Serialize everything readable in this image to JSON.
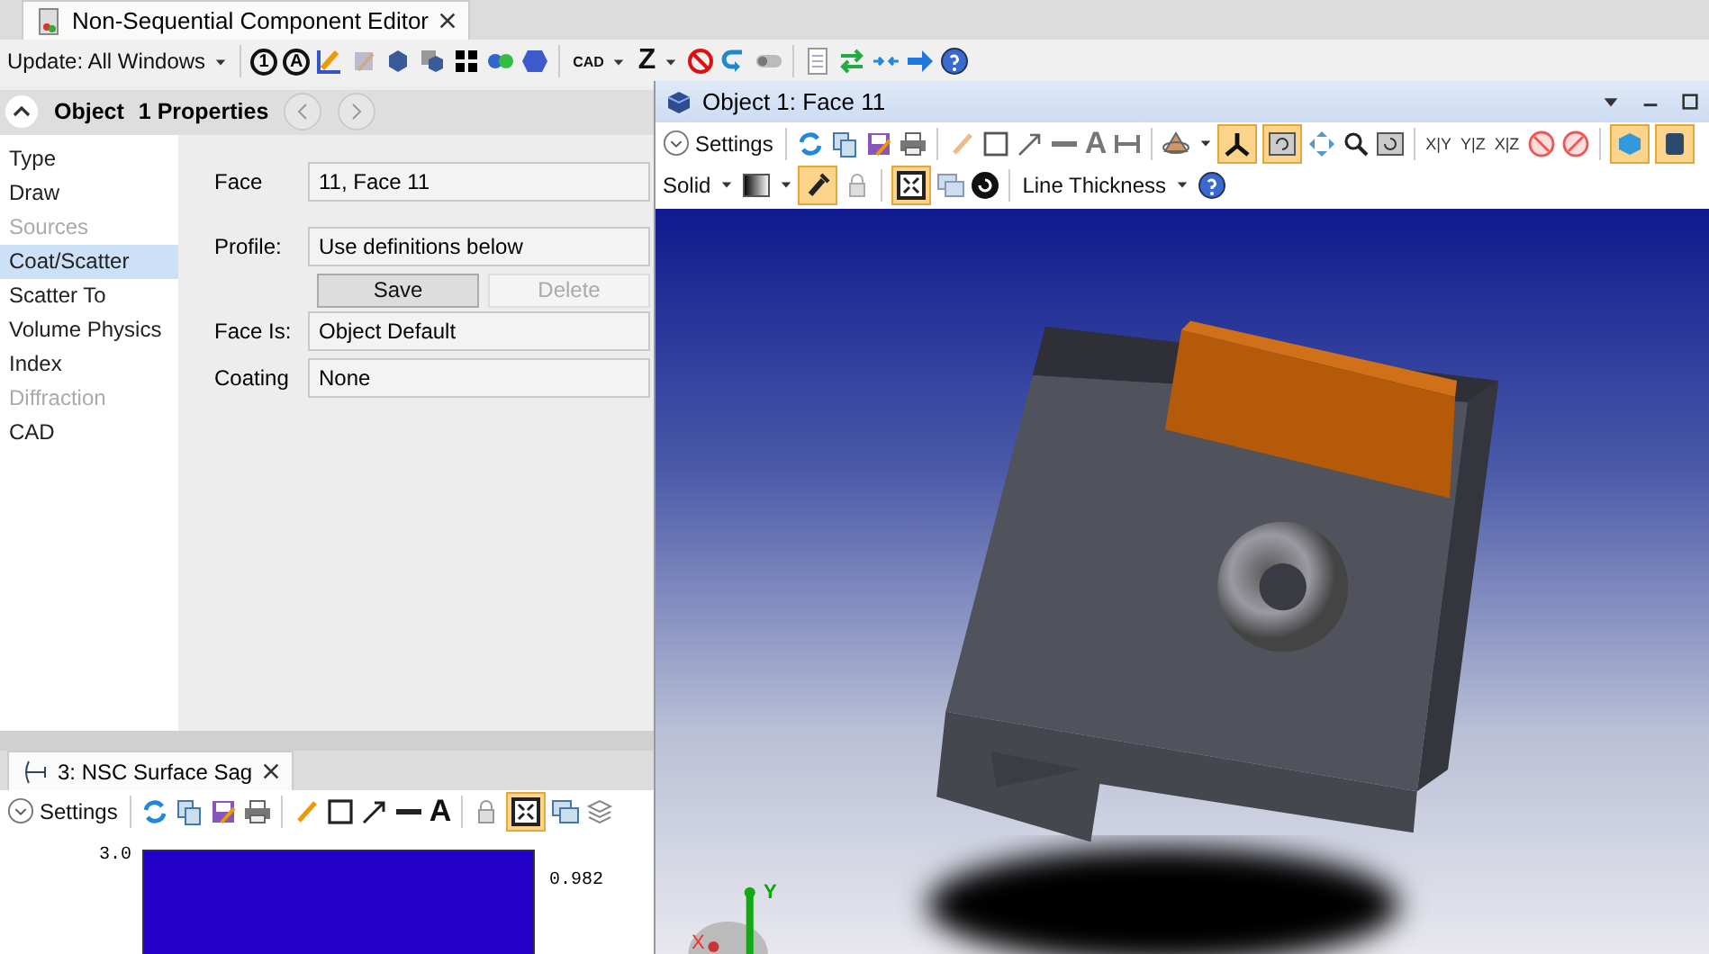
{
  "editor_tab": {
    "title": "Non-Sequential Component Editor",
    "selected": true
  },
  "main_toolbar": {
    "update_label": "Update: All Windows",
    "refresh_labels": [
      "1",
      "A"
    ],
    "cad_label": "CAD",
    "z_label": "Z",
    "switch_on": false
  },
  "object_bar": {
    "object_label": "Object",
    "properties_label": "1 Properties"
  },
  "sidebar": {
    "items": [
      {
        "label": "Type",
        "selected": false,
        "disabled": false
      },
      {
        "label": "Draw",
        "selected": false,
        "disabled": false
      },
      {
        "label": "Sources",
        "selected": false,
        "disabled": true
      },
      {
        "label": "Coat/Scatter",
        "selected": true,
        "disabled": false
      },
      {
        "label": "Scatter To",
        "selected": false,
        "disabled": false
      },
      {
        "label": "Volume Physics",
        "selected": false,
        "disabled": false
      },
      {
        "label": "Index",
        "selected": false,
        "disabled": false
      },
      {
        "label": "Diffraction",
        "selected": false,
        "disabled": true
      },
      {
        "label": "CAD",
        "selected": false,
        "disabled": false
      }
    ]
  },
  "form": {
    "face": {
      "label": "Face",
      "value": "11, Face 11"
    },
    "profile": {
      "label": "Profile:",
      "value": "Use definitions below"
    },
    "buttons": [
      {
        "label": "Save",
        "disabled": false
      },
      {
        "label": "Delete",
        "disabled": true
      }
    ],
    "face_is": {
      "label": "Face Is:",
      "value": "Object Default"
    },
    "coating": {
      "label": "Coating",
      "value": "None"
    }
  },
  "viewer": {
    "title": "Object 1: Face 11",
    "settings_label": "Settings",
    "plane_labels": [
      "X|Y",
      "Y|Z",
      "X|Z"
    ],
    "text_tool_label": "A",
    "solid_label": "Solid",
    "line_thickness_label": "Line Thickness",
    "toggles": {
      "axes": true,
      "rotate": true,
      "solid_model": true,
      "outline_model": true,
      "light": true,
      "fit": true
    },
    "axis_labels": {
      "y": "Y",
      "x": "X"
    }
  },
  "sag_window": {
    "tab_title": "3: NSC Surface Sag",
    "settings_label": "Settings",
    "text_tool_label": "A",
    "fit_on": true,
    "y_tick": "3.0",
    "right_label": "0.982"
  }
}
